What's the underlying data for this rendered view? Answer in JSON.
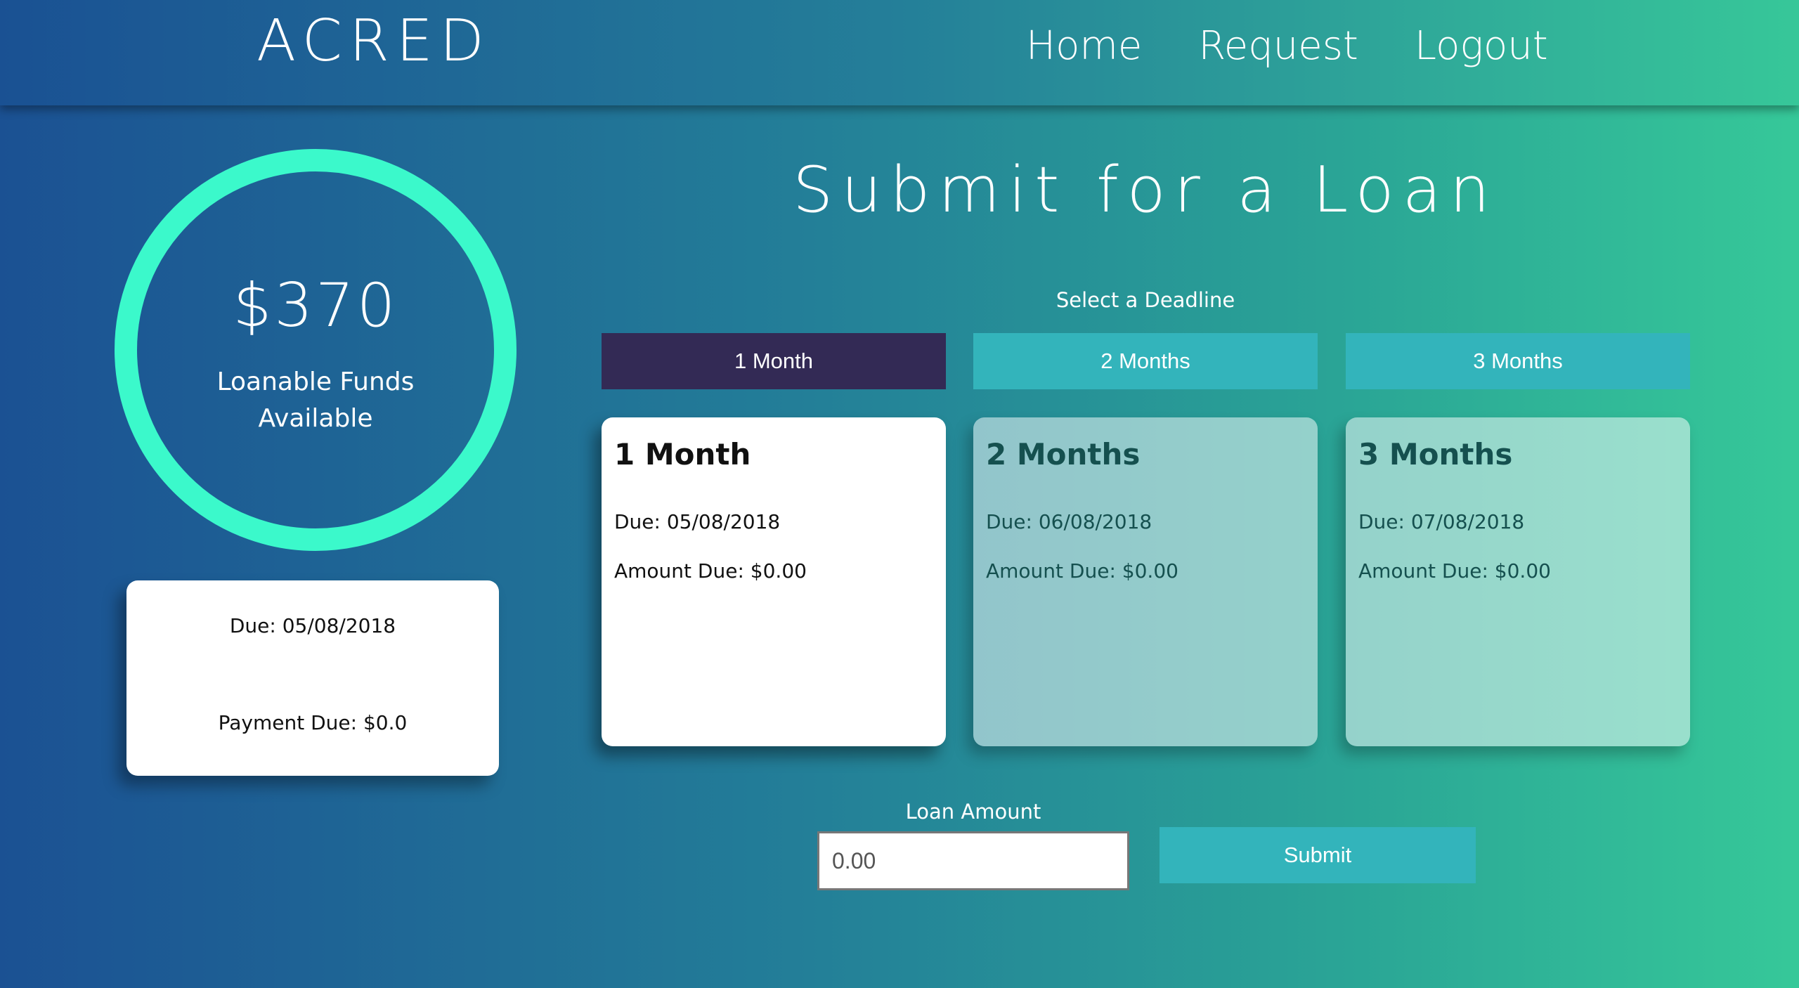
{
  "header": {
    "logo": "ACRED",
    "nav": [
      "Home",
      "Request",
      "Logout"
    ]
  },
  "funds": {
    "amount": "$370",
    "label": "Loanable Funds Available"
  },
  "payment_card": {
    "due": "Due: 05/08/2018",
    "payment": "Payment Due: $0.0"
  },
  "main": {
    "title": "Submit for a Loan",
    "deadline_label": "Select a Deadline",
    "tabs": [
      "1 Month",
      "2 Months",
      "3 Months"
    ],
    "active_tab": "1 Month",
    "cards": [
      {
        "title": "1 Month",
        "due": "Due: 05/08/2018",
        "amount": "Amount Due: $0.00"
      },
      {
        "title": "2 Months",
        "due": "Due: 06/08/2018",
        "amount": "Amount Due: $0.00"
      },
      {
        "title": "3 Months",
        "due": "Due: 07/08/2018",
        "amount": "Amount Due: $0.00"
      }
    ],
    "loan_amount_label": "Loan Amount",
    "loan_amount_placeholder": "0.00",
    "submit_label": "Submit"
  },
  "colors": {
    "accent_ring": "#3bf9cb",
    "active_tab": "#332a55",
    "tab": "#33b4bb",
    "gradient_start": "#1b5193",
    "gradient_end": "#36c899"
  }
}
